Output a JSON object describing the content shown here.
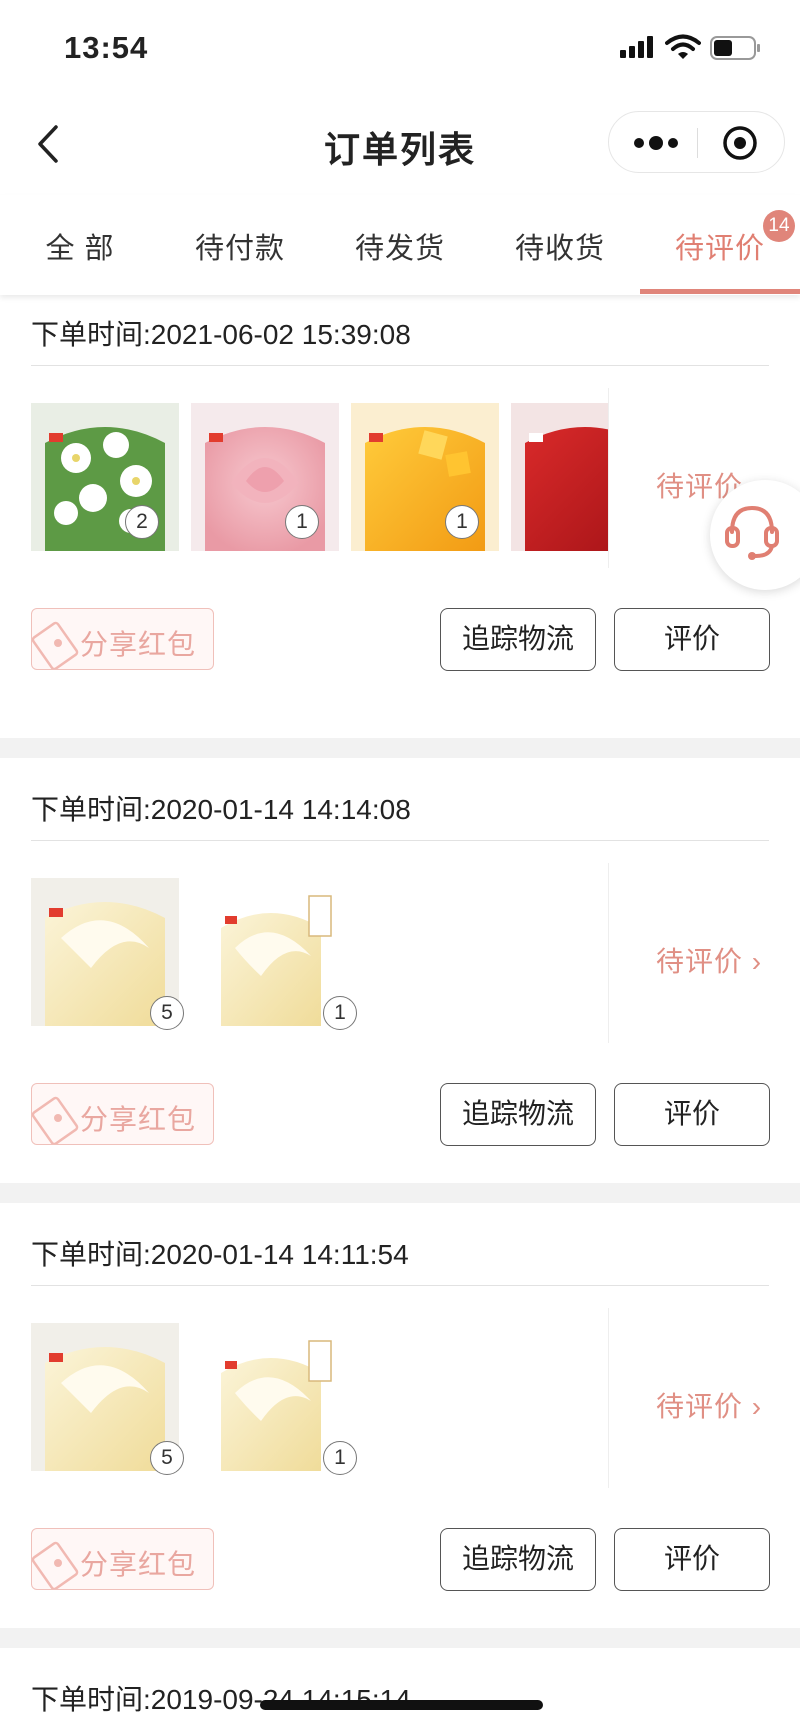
{
  "status_bar": {
    "time": "13:54"
  },
  "nav": {
    "title": "订单列表"
  },
  "tabs": [
    {
      "label": "全 部"
    },
    {
      "label": "待付款"
    },
    {
      "label": "待发货"
    },
    {
      "label": "待收货"
    },
    {
      "label": "待评价",
      "active": true,
      "badge": "14"
    }
  ],
  "orders": [
    {
      "time_label": "下单时间:2021-06-02 15:39:08",
      "status": "待评价 ›",
      "items": [
        {
          "image": "jasmine-cake",
          "qty": "2"
        },
        {
          "image": "rose-cake",
          "qty": "1"
        },
        {
          "image": "mango-cake",
          "qty": "1"
        },
        {
          "image": "red-cake",
          "qty": ""
        }
      ],
      "share_label": "分享红包",
      "track_label": "追踪物流",
      "rate_label": "评价"
    },
    {
      "time_label": "下单时间:2020-01-14 14:14:08",
      "status": "待评价 ›",
      "items": [
        {
          "image": "cream-cake",
          "qty": "5"
        },
        {
          "image": "cream-cake-limited",
          "qty": "1"
        }
      ],
      "share_label": "分享红包",
      "track_label": "追踪物流",
      "rate_label": "评价"
    },
    {
      "time_label": "下单时间:2020-01-14 14:11:54",
      "status": "待评价 ›",
      "items": [
        {
          "image": "cream-cake",
          "qty": "5"
        },
        {
          "image": "cream-cake-limited",
          "qty": "1"
        }
      ],
      "share_label": "分享红包",
      "track_label": "追踪物流",
      "rate_label": "评价"
    },
    {
      "time_label": "下单时间:2019-09-24 14:15:14"
    }
  ],
  "colors": {
    "accent": "#e0857a",
    "share_border": "#f0c0ba",
    "background": "#f2f2f2"
  }
}
